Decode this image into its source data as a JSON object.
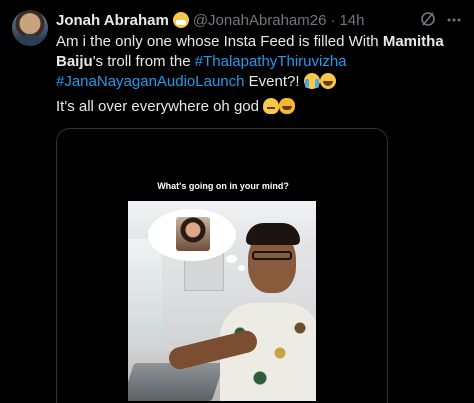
{
  "tweet": {
    "display_name": "Jonah Abraham",
    "handle": "@JonahAbraham26",
    "separator": "·",
    "time": "14h",
    "text_part1": "Am i the only one whose Insta Feed is filled With ",
    "bold_name": "Mamitha Baiju",
    "text_part2": "'s troll from the ",
    "hashtag1": "#ThalapathyThiruvizha",
    "hashtag2": "#JanaNayaganAudioLaunch",
    "text_part3": "Event?!",
    "line2": "It's all over everywhere oh god"
  },
  "media": {
    "caption": "What's going on in your mind?"
  },
  "colors": {
    "background": "#000000",
    "text": "#e7e9ea",
    "muted": "#71767b",
    "link": "#1d9bf0",
    "border": "#2f3336"
  },
  "icons": [
    "avatar",
    "face-with-mask-emoji",
    "grok-icon",
    "more-options-icon",
    "crying-face-emoji",
    "tears-of-joy-emoji",
    "melting-face-emoji",
    "grinning-cat-emoji"
  ]
}
